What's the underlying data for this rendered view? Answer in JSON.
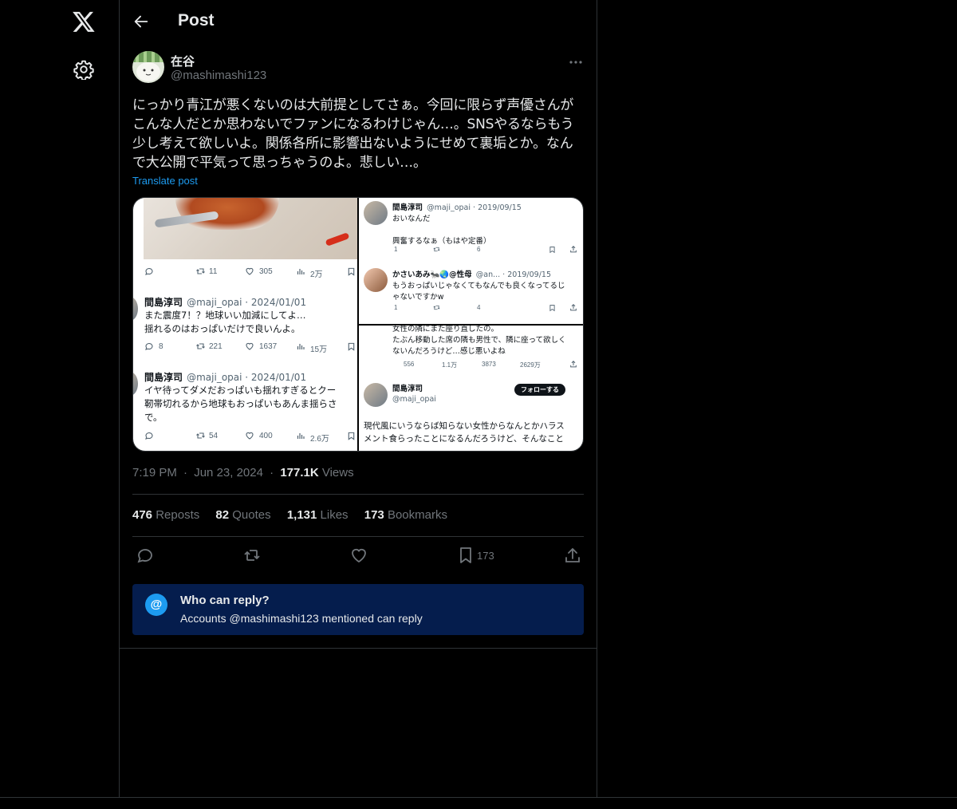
{
  "header": {
    "title": "Post"
  },
  "post": {
    "author_name": "在谷",
    "author_handle": "@mashimashi123",
    "text": "にっかり青江が悪くないのは大前提としてさぁ。今回に限らず声優さんがこんな人だとか思わないでファンになるわけじゃん…。SNSやるならもう少し考えて欲しいよ。関係各所に影響出ないようにせめて裏垢とか。なんで大公開で平気って思っちゃうのよ。悲しい…。",
    "translate_label": "Translate post",
    "time": "7:19 PM",
    "date": "Jun 23, 2024",
    "views_count": "177.1K",
    "views_label": "Views",
    "sep": "·"
  },
  "media": {
    "img1": {
      "row1_stats": [
        "11",
        "305",
        "2万"
      ],
      "tweet_a": {
        "name": "間島淳司",
        "meta": "@maji_opai · 2024/01/01",
        "line1": "また震度7！？地球いい加減にしてよ…",
        "line2": "揺れるのはおっぱいだけで良いんよ。",
        "stats": [
          "8",
          "221",
          "1637",
          "15万"
        ]
      },
      "tweet_b": {
        "name": "間島淳司",
        "meta": "@maji_opai · 2024/01/01",
        "line1": "イヤ待ってダメだおっぱいも揺れすぎるとクー",
        "line2": "靭帯切れるから地球もおっぱいもあんま揺らさ",
        "line3": "で。",
        "stats": [
          "54",
          "400",
          "2.6万"
        ]
      }
    },
    "img2": {
      "tweet_a": {
        "name": "間島淳司",
        "meta": "@maji_opai · 2019/09/15",
        "line1": "おいなんだ",
        "line2": "興奮するなぁ（もはや定番）",
        "stats": [
          "1",
          "6"
        ]
      },
      "tweet_b": {
        "name": "かさいあみ🐜🌏@性母",
        "meta": "@an... · 2019/09/15",
        "line1": "もうおっぱいじゃなくてもなんでも良くなってるじ",
        "line2": "ゃないですかw",
        "stats": [
          "1",
          "4"
        ]
      }
    },
    "img3": {
      "line1": "女性の隣にまた座り直したの。",
      "line2": "たぶん移動した席の隣も男性で、隣に座って欲しく",
      "line3": "ないんだろうけど…感じ悪いよね",
      "stats": [
        "556",
        "1.1万",
        "3873",
        "2629万"
      ],
      "name": "間島淳司",
      "handle": "@maji_opai",
      "follow_label": "フォローする",
      "body1": "現代風にいうならば知らない女性からなんとかハラス",
      "body2": "メント食らったことになるんだろうけど、そんなこと"
    }
  },
  "engagement": {
    "reposts": {
      "count": "476",
      "label": "Reposts"
    },
    "quotes": {
      "count": "82",
      "label": "Quotes"
    },
    "likes": {
      "count": "1,131",
      "label": "Likes"
    },
    "bookmarks": {
      "count": "173",
      "label": "Bookmarks"
    },
    "bookmark_action_count": "173"
  },
  "reply_box": {
    "icon": "@",
    "title": "Who can reply?",
    "subtitle": "Accounts @mashimashi123 mentioned can reply"
  },
  "colors": {
    "background": "#000000",
    "text": "#e7e9ea",
    "muted": "#71767b",
    "link": "#1d9bf0",
    "reply_box": "#051d4d",
    "border": "#2f3336"
  }
}
